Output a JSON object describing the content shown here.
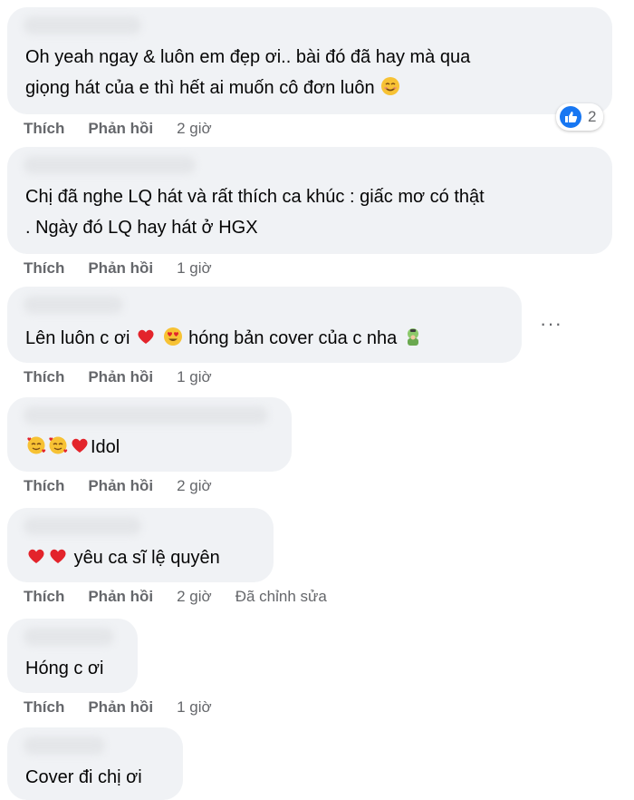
{
  "comments": [
    {
      "text_lines": [
        "Oh yeah ngay & luôn em đẹp ơi.. bài đó đã hay mà qua",
        "giọng hát của e thì hết ai muốn cô đơn luôn"
      ],
      "like": "Thích",
      "reply": "Phản hồi",
      "time": "2 giờ",
      "reaction_count": "2"
    },
    {
      "text_lines": [
        "Chị đã nghe LQ hát và rất thích ca khúc : giấc mơ có thật",
        ". Ngày đó LQ hay hát ở HGX"
      ],
      "like": "Thích",
      "reply": "Phản hồi",
      "time": "1 giờ"
    },
    {
      "text_a": "Lên luôn c ơi",
      "text_b": "hóng bản cover của c nha",
      "like": "Thích",
      "reply": "Phản hồi",
      "time": "1 giờ",
      "more": "···"
    },
    {
      "text": "Idol",
      "like": "Thích",
      "reply": "Phản hồi",
      "time": "2 giờ"
    },
    {
      "text": "yêu ca sĩ lệ quyên",
      "like": "Thích",
      "reply": "Phản hồi",
      "time": "2 giờ",
      "edited": "Đã chỉnh sửa"
    },
    {
      "text": "Hóng c ơi",
      "like": "Thích",
      "reply": "Phản hồi",
      "time": "1 giờ"
    },
    {
      "text": "Cover đi chị ơi"
    }
  ],
  "colors": {
    "bubble": "#f0f2f5",
    "meta": "#65676b",
    "like_blue": "#1877f2",
    "heart": "#f33e58"
  },
  "icons": [
    "smiling-face-icon",
    "heart-icon",
    "heart-eyes-icon",
    "face-palm-icon",
    "smiling-hearts-icon",
    "like-thumb-icon"
  ]
}
